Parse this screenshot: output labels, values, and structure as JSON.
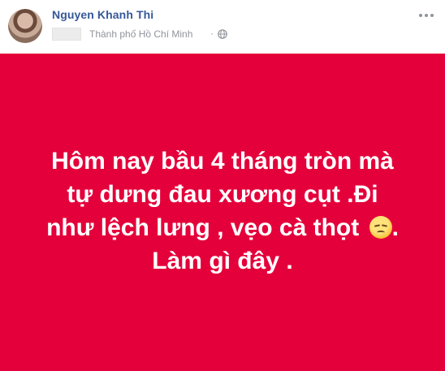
{
  "post": {
    "author_name": "Nguyen Khanh Thi",
    "location": "Thành phố Hồ Chí Minh",
    "separator": "·",
    "privacy_icon": "globe-icon",
    "options_icon": "more-options-icon",
    "status_background_color": "#e4003a",
    "status_lines": [
      "Hôm nay bầu 4 tháng tròn mà",
      "tự dưng đau xương cụt .Đi",
      "như lệch lưng , vẹo cà thọt",
      "Làm gì đây ."
    ],
    "status_line3_suffix": ".",
    "emoji_icon": "disappointed-face-emoji"
  }
}
